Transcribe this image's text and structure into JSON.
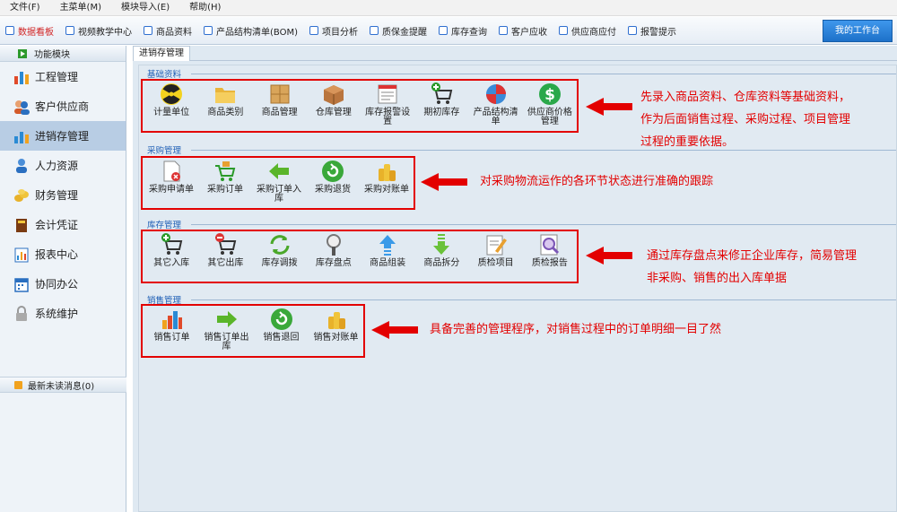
{
  "menubar": [
    "文件(F)",
    "主菜单(M)",
    "模块导入(E)",
    "帮助(H)"
  ],
  "toolbar": {
    "items": [
      "数据看板",
      "视频教学中心",
      "商品资料",
      "产品结构清单(BOM)",
      "项目分析",
      "质保金提醒",
      "库存查询",
      "客户应收",
      "供应商应付",
      "报警提示"
    ],
    "workbench": "我的工作台"
  },
  "sidebar": {
    "header": "功能模块",
    "items": [
      "工程管理",
      "客户供应商",
      "进销存管理",
      "人力资源",
      "财务管理",
      "会计凭证",
      "报表中心",
      "协同办公",
      "系统维护"
    ],
    "active": "进销存管理",
    "messages": "最新未读消息(0)"
  },
  "tab": "进销存管理",
  "sections": [
    {
      "title": "基础资料",
      "modules": [
        "计量单位",
        "商品类别",
        "商品管理",
        "仓库管理",
        "库存报警设置",
        "期初库存",
        "产品结构清单",
        "供应商价格管理"
      ],
      "note": [
        "先录入商品资料、仓库资料等基础资料，",
        "作为后面销售过程、采购过程、项目管理",
        "过程的重要依据。"
      ]
    },
    {
      "title": "采购管理",
      "modules": [
        "采购申请单",
        "采购订单",
        "采购订单入库",
        "采购退货",
        "采购对账单"
      ],
      "note": [
        "对采购物流运作的各环节状态进行准确的跟踪"
      ]
    },
    {
      "title": "库存管理",
      "modules": [
        "其它入库",
        "其它出库",
        "库存调拨",
        "库存盘点",
        "商品组装",
        "商品拆分",
        "质检项目",
        "质检报告"
      ],
      "note": [
        "通过库存盘点来修正企业库存，简易管理",
        "非采购、销售的出入库单据"
      ]
    },
    {
      "title": "销售管理",
      "modules": [
        "销售订单",
        "销售订单出库",
        "销售退回",
        "销售对账单"
      ],
      "note": [
        "具备完善的管理程序，对销售过程中的订单明细一目了然"
      ]
    }
  ],
  "colors": {
    "accent": "#1f5fb5",
    "highlight": "#e30000",
    "active_sidebar": "#b8cde4"
  }
}
